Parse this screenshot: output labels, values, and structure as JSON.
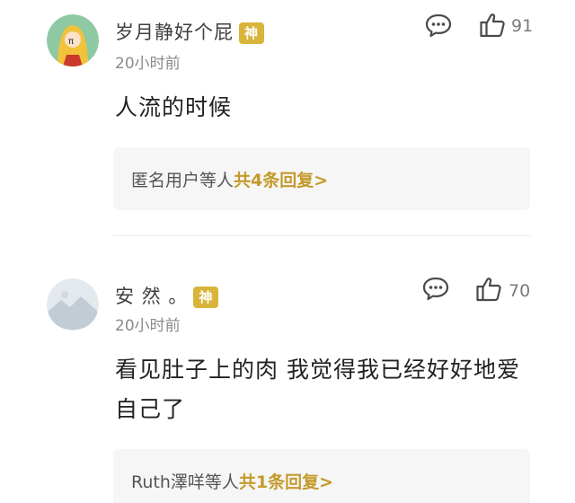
{
  "comments": [
    {
      "username": "岁月静好个屁",
      "badge": "神",
      "time": "20小时前",
      "like_count": "91",
      "content": "人流的时候",
      "reply": {
        "names": "匿名用户",
        "suffix": "等人",
        "link": "共4条回复>"
      }
    },
    {
      "username": "安 然 。",
      "badge": "神",
      "time": "20小时前",
      "like_count": "70",
      "content": "看见肚子上的肉 我觉得我已经好好地爱自己了",
      "reply": {
        "names": "Ruth澤咩",
        "suffix": "等人",
        "link": "共1条回复>"
      }
    }
  ],
  "colors": {
    "badge": "#d9b43a",
    "reply_link": "#c49a2c",
    "reply_bg": "#f6f6f6"
  },
  "icons": [
    "comment-icon",
    "like-icon"
  ]
}
